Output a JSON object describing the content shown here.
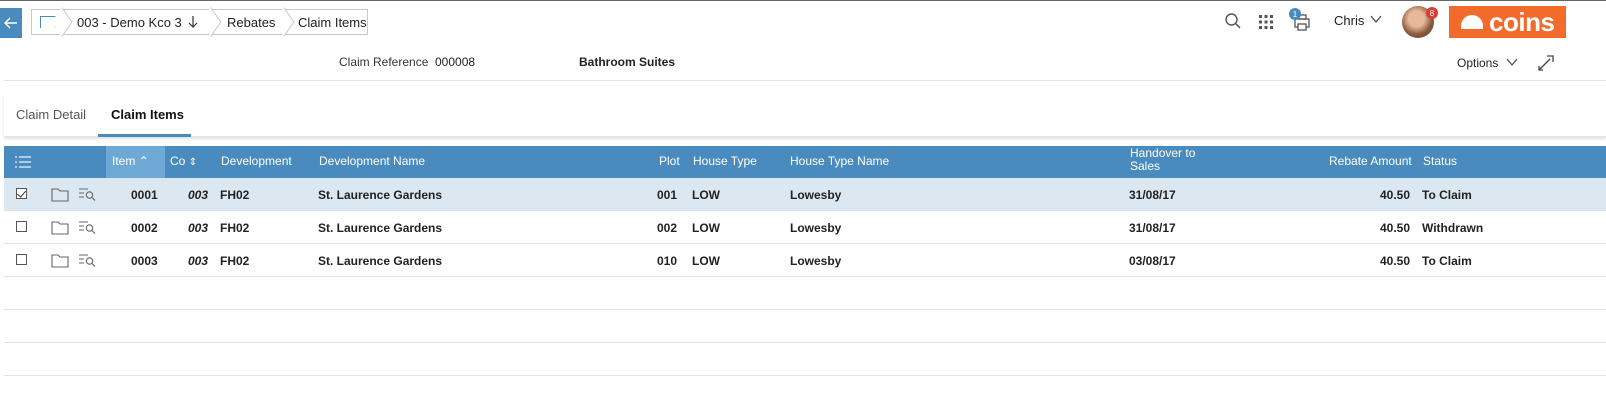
{
  "breadcrumb": {
    "items": [
      {
        "label": "003 - Demo Kco 3"
      },
      {
        "label": "Rebates"
      },
      {
        "label": "Claim Items"
      }
    ]
  },
  "topbar": {
    "print_badge": "1",
    "user_name": "Chris",
    "avatar_badge": "8",
    "logo_text": "coins"
  },
  "claim": {
    "reference_label": "Claim Reference",
    "reference_value": "000008",
    "description": "Bathroom Suites",
    "options_label": "Options"
  },
  "tabs": [
    {
      "label": "Claim Detail",
      "active": false
    },
    {
      "label": "Claim Items",
      "active": true
    }
  ],
  "table": {
    "headers": {
      "item": "Item",
      "co": "Co",
      "development": "Development",
      "development_name": "Development Name",
      "plot": "Plot",
      "house_type": "House Type",
      "house_type_name": "House Type Name",
      "handover_line1": "Handover to",
      "handover_line2": "Sales",
      "rebate_amount": "Rebate Amount",
      "status": "Status"
    },
    "rows": [
      {
        "checked": true,
        "item": "0001",
        "co": "003",
        "development": "FH02",
        "development_name": "St. Laurence Gardens",
        "plot": "001",
        "house_type": "LOW",
        "house_type_name": "Lowesby",
        "handover": "31/08/17",
        "rebate_amount": "40.50",
        "status": "To Claim"
      },
      {
        "checked": false,
        "item": "0002",
        "co": "003",
        "development": "FH02",
        "development_name": "St. Laurence Gardens",
        "plot": "002",
        "house_type": "LOW",
        "house_type_name": "Lowesby",
        "handover": "31/08/17",
        "rebate_amount": "40.50",
        "status": "Withdrawn"
      },
      {
        "checked": false,
        "item": "0003",
        "co": "003",
        "development": "FH02",
        "development_name": "St. Laurence Gardens",
        "plot": "010",
        "house_type": "LOW",
        "house_type_name": "Lowesby",
        "handover": "03/08/17",
        "rebate_amount": "40.50",
        "status": "To Claim"
      }
    ]
  },
  "colors": {
    "accent": "#4a8bbf",
    "header_sort": "#6ea8d4",
    "selected_row": "#dbe8f2",
    "brand": "#f26b2b",
    "badge_red": "#e03b2f"
  }
}
